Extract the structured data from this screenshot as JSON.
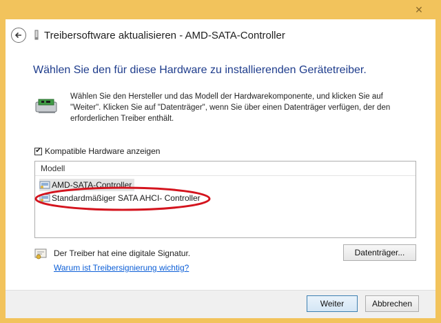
{
  "window": {
    "close_glyph": "✕",
    "title": "Treibersoftware aktualisieren - AMD-SATA-Controller"
  },
  "heading": "Wählen Sie den für diese Hardware zu installierenden Gerätetreiber.",
  "description": "Wählen Sie den Hersteller und das Modell der Hardwarekomponente, und klicken Sie auf \"Weiter\". Klicken Sie auf \"Datenträger\", wenn Sie über einen Datenträger verfügen, der den erforderlichen Treiber enthält.",
  "compatible": {
    "label": "Kompatible Hardware anzeigen",
    "checked": true,
    "mark": "✔"
  },
  "model_list": {
    "header": "Modell",
    "items": [
      {
        "label": "AMD-SATA-Controller",
        "selected": true
      },
      {
        "label": "Standardmäßiger SATA AHCI- Controller",
        "selected": false
      }
    ]
  },
  "signature": {
    "text": "Der Treiber hat eine digitale Signatur.",
    "link": "Warum ist Treibersignierung wichtig?"
  },
  "buttons": {
    "disk": "Datenträger...",
    "next": "Weiter",
    "cancel": "Abbrechen"
  },
  "colors": {
    "title_bar": "#f2c35c",
    "heading": "#1e3c8c",
    "link": "#0b5ed7",
    "annotation": "#d4141e"
  }
}
